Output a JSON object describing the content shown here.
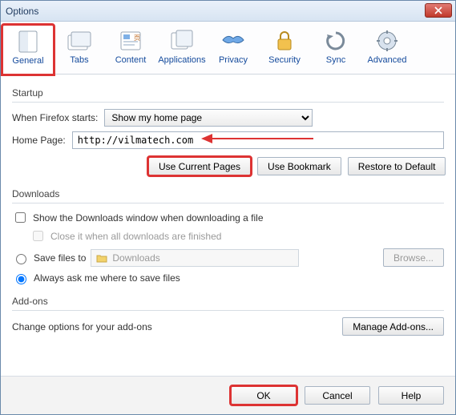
{
  "window": {
    "title": "Options"
  },
  "toolbar": {
    "items": [
      {
        "label": "General"
      },
      {
        "label": "Tabs"
      },
      {
        "label": "Content"
      },
      {
        "label": "Applications"
      },
      {
        "label": "Privacy"
      },
      {
        "label": "Security"
      },
      {
        "label": "Sync"
      },
      {
        "label": "Advanced"
      }
    ]
  },
  "startup": {
    "group_label": "Startup",
    "when_starts_label": "When Firefox starts:",
    "when_starts_value": "Show my home page",
    "home_page_label": "Home Page:",
    "home_page_value": "http://vilmatech.com",
    "use_current_label": "Use Current Pages",
    "use_bookmark_label": "Use Bookmark",
    "restore_default_label": "Restore to Default"
  },
  "downloads": {
    "group_label": "Downloads",
    "show_window_label": "Show the Downloads window when downloading a file",
    "close_when_done_label": "Close it when all downloads are finished",
    "save_to_label": "Save files to",
    "save_to_path": "Downloads",
    "browse_label": "Browse...",
    "always_ask_label": "Always ask me where to save files"
  },
  "addons": {
    "group_label": "Add-ons",
    "desc": "Change options for your add-ons",
    "manage_label": "Manage Add-ons..."
  },
  "footer": {
    "ok": "OK",
    "cancel": "Cancel",
    "help": "Help"
  }
}
